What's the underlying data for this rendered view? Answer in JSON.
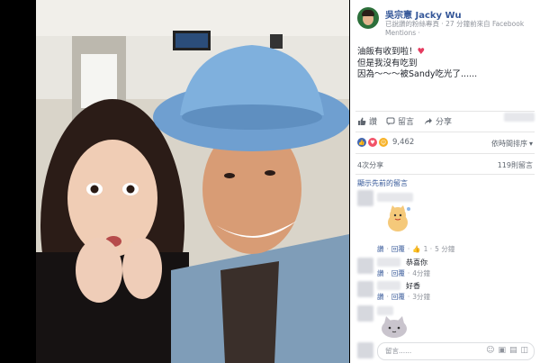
{
  "post": {
    "author": "吳宗憲 Jacky Wu",
    "meta": "已說讚的粉絲專頁 · 27 分鐘前來自 Facebook Mentions · ",
    "text_lines": [
      "油飯有收到啦！",
      "但是我沒有吃到",
      "因為～～～被Sandy吃光了......"
    ]
  },
  "actions": {
    "like": "讚",
    "comment": "留言",
    "share": "分享"
  },
  "reactions": {
    "count": "9,462",
    "sort_label": "依時間排序"
  },
  "stats": {
    "shares": "4次分享",
    "comments": "119則留言"
  },
  "comments": {
    "view_previous": "顯示先前的留言",
    "list": [
      {
        "text": "",
        "like_label": "讚",
        "reply_label": "回覆",
        "time": "5 分鐘"
      },
      {
        "text": "恭喜你",
        "like_label": "讚",
        "reply_label": "回覆",
        "time": "4分鐘"
      },
      {
        "text": "好香",
        "like_label": "讚",
        "reply_label": "回覆",
        "time": "3分鐘"
      }
    ]
  },
  "composer": {
    "placeholder": "留言......"
  },
  "colors": {
    "link": "#365899",
    "meta": "#90949c",
    "like": "#4267b2",
    "love": "#f25268",
    "haha": "#f7b125"
  },
  "icons": [
    "like-icon",
    "comment-icon",
    "share-icon",
    "camera-icon",
    "emoji-icon",
    "gif-icon",
    "sticker-icon",
    "chevron-down-icon"
  ]
}
